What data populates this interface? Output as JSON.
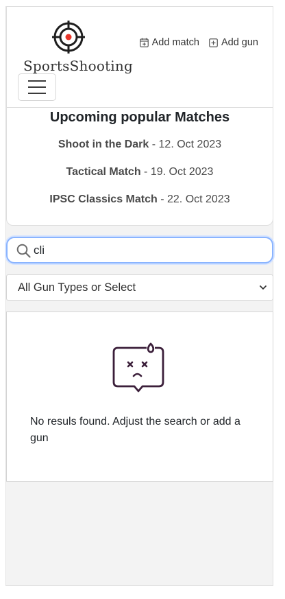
{
  "brand": {
    "name": "SportsShooting",
    "logo_icon": "crosshair-target-icon",
    "accent": "#e8362a"
  },
  "nav": {
    "add_match": {
      "label": "Add match",
      "icon": "calendar-plus-icon"
    },
    "add_gun": {
      "label": "Add gun",
      "icon": "plus-square-icon"
    },
    "toggler_icon": "hamburger-menu-icon"
  },
  "matches": {
    "title": "Upcoming popular Matches",
    "items": [
      {
        "name": "Shoot in the Dark",
        "date": " - 12. Oct 2023"
      },
      {
        "name": "Tactical Match",
        "date": " - 19. Oct 2023"
      },
      {
        "name": "IPSC Classics Match",
        "date": " - 22. Oct 2023"
      }
    ]
  },
  "search": {
    "value": "cli",
    "icon": "search-icon",
    "focus_color": "#8ab4ff"
  },
  "filter": {
    "selected": "All Gun Types or Select",
    "icon": "chevron-down-icon"
  },
  "results": {
    "empty_icon": "sad-face-box-icon",
    "empty_text": "No resuls found. Adjust the search or add a gun",
    "icon_color": "#3b1f3a"
  }
}
